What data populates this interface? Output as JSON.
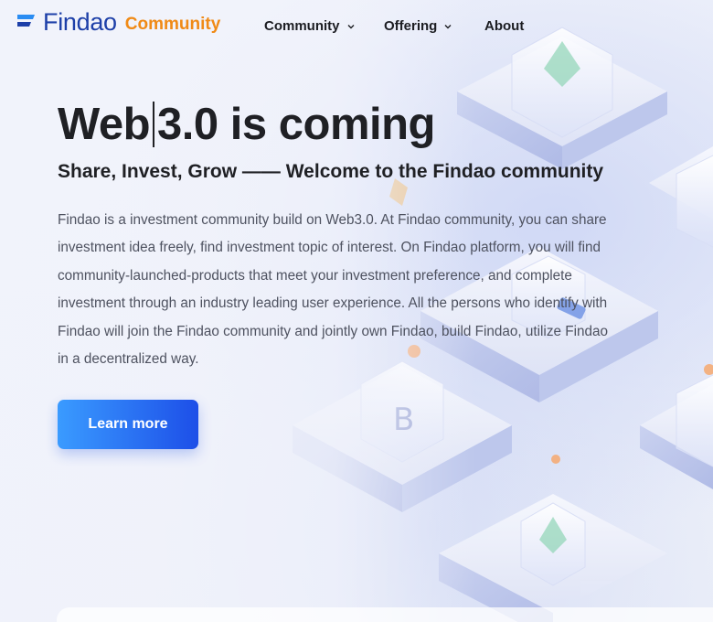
{
  "nav": {
    "brand": "Findao",
    "brand_sub": "Community",
    "items": [
      {
        "label": "Community",
        "has_dropdown": true
      },
      {
        "label": "Offering",
        "has_dropdown": true
      },
      {
        "label": "About",
        "has_dropdown": false
      }
    ]
  },
  "hero": {
    "title_before": "Web",
    "title_after": "3.0 is coming",
    "subtitle": "Share, Invest, Grow —— Welcome to the Findao community",
    "description": "Findao is a investment community build on Web3.0. At Findao community, you can share investment idea freely, find investment topic of interest. On Findao platform, you will find community-launched-products that meet your investment preference, and complete investment through an industry leading user experience. All the persons who identify with Findao will join the Findao community and jointly own Findao, build Findao, utilize Findao in a decentralized way.",
    "cta_label": "Learn more"
  },
  "colors": {
    "brand": "#1d3fa8",
    "accent": "#f08a16",
    "button_start": "#3a9bff",
    "button_end": "#1d4fe8"
  }
}
